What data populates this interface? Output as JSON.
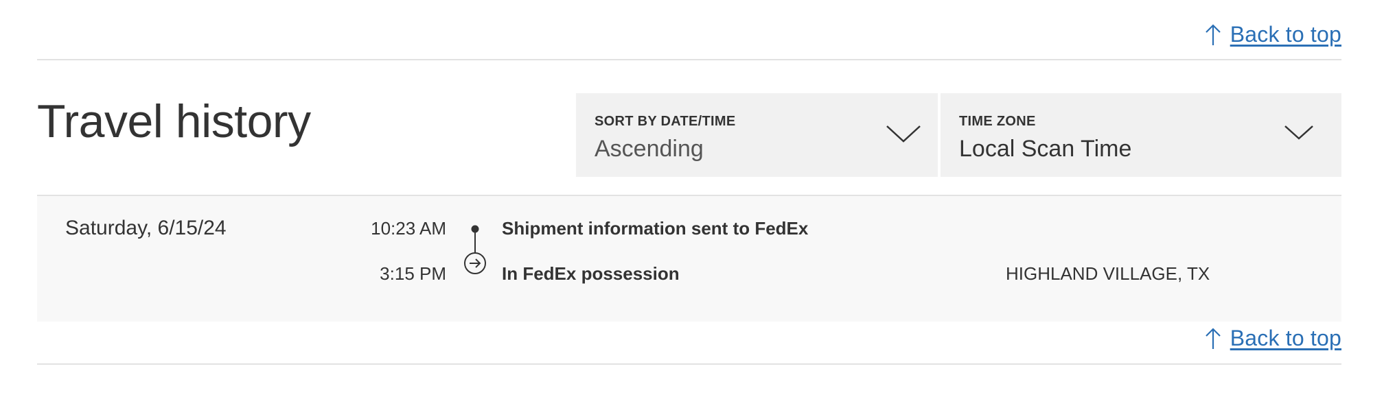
{
  "back_to_top_label": "Back to top",
  "travel_history": {
    "title": "Travel history",
    "sort": {
      "label": "SORT BY DATE/TIME",
      "value": "Ascending"
    },
    "time_zone": {
      "label": "TIME ZONE",
      "value": "Local Scan Time"
    },
    "days": [
      {
        "date": "Saturday, 6/15/24",
        "events": [
          {
            "time": "10:23 AM",
            "status": "Shipment information sent to FedEx",
            "location": "",
            "icon": "dot-icon"
          },
          {
            "time": "3:15 PM",
            "status": "In FedEx possession",
            "location": "HIGHLAND VILLAGE, TX",
            "icon": "arrow-circle-icon"
          }
        ]
      }
    ]
  },
  "colors": {
    "link": "#2a6fb5",
    "text": "#333333",
    "dropdown_bg": "#f1f1f1",
    "panel_bg": "#f8f8f8",
    "divider": "#e2e2e2"
  }
}
